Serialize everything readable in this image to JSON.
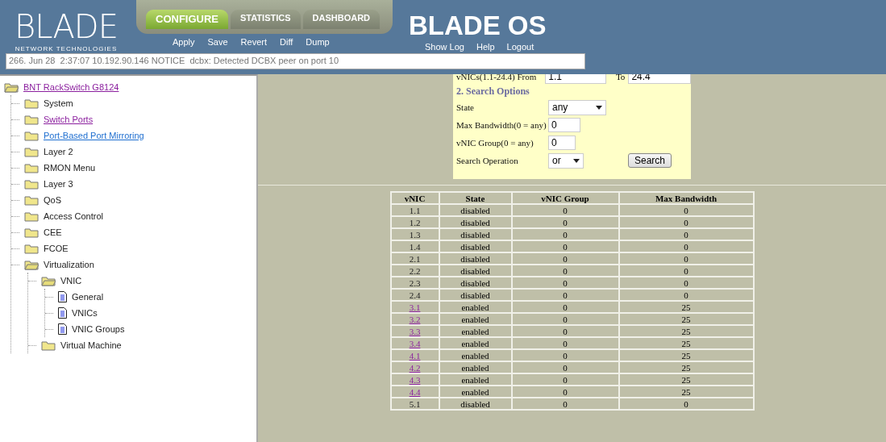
{
  "header": {
    "logo": "BLADE",
    "logo_sub": "NETWORK TECHNOLOGIES",
    "product": "BLADE OS",
    "tabs": [
      {
        "label": "CONFIGURE",
        "selected": true
      },
      {
        "label": "STATISTICS",
        "selected": false
      },
      {
        "label": "DASHBOARD",
        "selected": false
      }
    ],
    "actions": [
      "Apply",
      "Save",
      "Revert",
      "Diff",
      "Dump"
    ],
    "links": [
      "Show Log",
      "Help",
      "Logout"
    ],
    "log_message": "266. Jun 28  2:37:07 10.192.90.146 NOTICE  dcbx: Detected DCBX peer on port 10"
  },
  "tree": {
    "label": "BNT RackSwitch G8124",
    "linked": true,
    "visited": true,
    "expanded": true,
    "children": [
      {
        "label": "System",
        "kind": "folder",
        "expanded": false
      },
      {
        "label": "Switch Ports",
        "kind": "folder",
        "expanded": false,
        "linked": true,
        "visited": true
      },
      {
        "label": "Port-Based Port Mirroring",
        "kind": "folder",
        "expanded": false,
        "linked": true,
        "visited": false
      },
      {
        "label": "Layer 2",
        "kind": "folder",
        "expanded": false
      },
      {
        "label": "RMON Menu",
        "kind": "folder",
        "expanded": false
      },
      {
        "label": "Layer 3",
        "kind": "folder",
        "expanded": false
      },
      {
        "label": "QoS",
        "kind": "folder",
        "expanded": false
      },
      {
        "label": "Access Control",
        "kind": "folder",
        "expanded": false
      },
      {
        "label": "CEE",
        "kind": "folder",
        "expanded": false
      },
      {
        "label": "FCOE",
        "kind": "folder",
        "expanded": false
      },
      {
        "label": "Virtualization",
        "kind": "folder",
        "expanded": true,
        "children": [
          {
            "label": "VNIC",
            "kind": "folder",
            "expanded": true,
            "children": [
              {
                "label": "General",
                "kind": "page"
              },
              {
                "label": "VNICs",
                "kind": "page"
              },
              {
                "label": "VNIC Groups",
                "kind": "page"
              }
            ]
          },
          {
            "label": "Virtual Machine",
            "kind": "folder",
            "expanded": false
          }
        ]
      }
    ]
  },
  "search_form": {
    "range_label": "vNICs(1.1-24.4) From",
    "from_value": "1.1",
    "to_label": "To",
    "to_value": "24.4",
    "section_title": "2. Search Options",
    "fields": [
      {
        "label": "State",
        "kind": "select",
        "value": "any"
      },
      {
        "label": "Max Bandwidth(0 = any)",
        "kind": "input",
        "value": "0"
      },
      {
        "label": "vNIC Group(0 = any)",
        "kind": "input",
        "value": "0"
      },
      {
        "label": "Search Operation",
        "kind": "select",
        "value": "or"
      }
    ],
    "button": "Search"
  },
  "table": {
    "columns": [
      "vNIC",
      "State",
      "vNIC Group",
      "Max Bandwidth"
    ],
    "rows": [
      {
        "vnic": "1.1",
        "linked": false,
        "state": "disabled",
        "group": "0",
        "bandwidth": "0"
      },
      {
        "vnic": "1.2",
        "linked": false,
        "state": "disabled",
        "group": "0",
        "bandwidth": "0"
      },
      {
        "vnic": "1.3",
        "linked": false,
        "state": "disabled",
        "group": "0",
        "bandwidth": "0"
      },
      {
        "vnic": "1.4",
        "linked": false,
        "state": "disabled",
        "group": "0",
        "bandwidth": "0"
      },
      {
        "vnic": "2.1",
        "linked": false,
        "state": "disabled",
        "group": "0",
        "bandwidth": "0"
      },
      {
        "vnic": "2.2",
        "linked": false,
        "state": "disabled",
        "group": "0",
        "bandwidth": "0"
      },
      {
        "vnic": "2.3",
        "linked": false,
        "state": "disabled",
        "group": "0",
        "bandwidth": "0"
      },
      {
        "vnic": "2.4",
        "linked": false,
        "state": "disabled",
        "group": "0",
        "bandwidth": "0"
      },
      {
        "vnic": "3.1",
        "linked": true,
        "state": "enabled",
        "group": "0",
        "bandwidth": "25"
      },
      {
        "vnic": "3.2",
        "linked": true,
        "state": "enabled",
        "group": "0",
        "bandwidth": "25"
      },
      {
        "vnic": "3.3",
        "linked": true,
        "state": "enabled",
        "group": "0",
        "bandwidth": "25"
      },
      {
        "vnic": "3.4",
        "linked": true,
        "state": "enabled",
        "group": "0",
        "bandwidth": "25"
      },
      {
        "vnic": "4.1",
        "linked": true,
        "state": "enabled",
        "group": "0",
        "bandwidth": "25"
      },
      {
        "vnic": "4.2",
        "linked": true,
        "state": "enabled",
        "group": "0",
        "bandwidth": "25"
      },
      {
        "vnic": "4.3",
        "linked": true,
        "state": "enabled",
        "group": "0",
        "bandwidth": "25"
      },
      {
        "vnic": "4.4",
        "linked": true,
        "state": "enabled",
        "group": "0",
        "bandwidth": "25"
      },
      {
        "vnic": "5.1",
        "linked": false,
        "state": "disabled",
        "group": "0",
        "bandwidth": "0"
      }
    ]
  }
}
